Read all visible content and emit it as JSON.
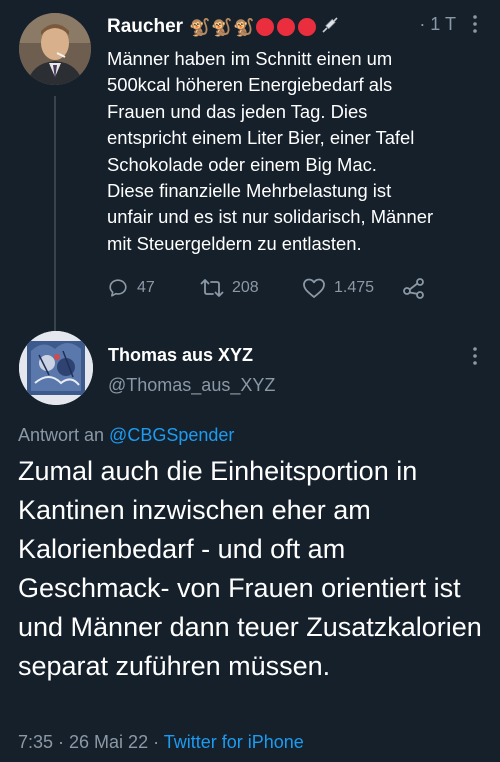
{
  "tweet1": {
    "author_name": "Raucher",
    "name_emojis": [
      "🐒",
      "🐒",
      "🐒"
    ],
    "red_dot_count": 3,
    "accent_red": "#ea2e3e",
    "time": "· 1 T",
    "text": "Männer haben im Schnitt einen um\n500kcal höheren Energiebedarf als\nFrauen und das jeden Tag. Dies\nentspricht einem Liter Bier, einer Tafel\nSchokolade oder einem Big Mac.\nDiese finanzielle Mehrbelastung ist\nunfair und es ist nur solidarisch, Männer\nmit Steuergeldern zu entlasten.",
    "replies": "47",
    "retweets": "208",
    "likes": "1.475"
  },
  "tweet2": {
    "author_name": "Thomas aus XYZ",
    "handle": "@Thomas_aus_XYZ",
    "reply_prefix": "Antwort an ",
    "reply_handle": "@CBGSpender",
    "text": "Zumal auch die Einheitsportion in Kantinen inzwischen eher am Kalorienbedarf - und oft am Geschmack- von Frauen orientiert ist und Männer dann teuer Zusatzkalorien separat zuführen müssen.",
    "timestamp": "7:35 · 26 Mai 22 · ",
    "source": "Twitter for iPhone"
  },
  "colors": {
    "background": "#15202b",
    "muted_text": "#8b98a5",
    "link": "#1d9bf0"
  }
}
